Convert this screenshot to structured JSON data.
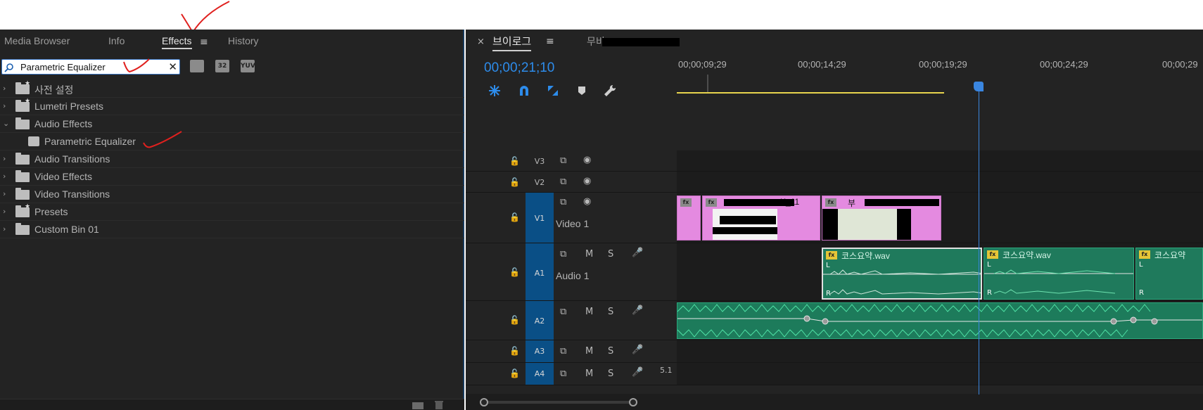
{
  "effects_panel": {
    "tabs": [
      {
        "label": "Media Browser",
        "active": false
      },
      {
        "label": "Info",
        "active": false
      },
      {
        "label": "Effects",
        "active": true
      },
      {
        "label": "History",
        "active": false
      }
    ],
    "menu_glyph": "≡",
    "search": {
      "value": "Parametric Equalizer",
      "clear_glyph": "✕"
    },
    "toolbar": {
      "accelerated": "",
      "bit32": "32",
      "yuv": "YUV"
    },
    "tree": [
      {
        "label": "사전 설정",
        "expanded": false,
        "preset": true
      },
      {
        "label": "Lumetri Presets",
        "expanded": false,
        "preset": true
      },
      {
        "label": "Audio Effects",
        "expanded": true,
        "preset": false
      },
      {
        "label": "Parametric Equalizer",
        "child": true
      },
      {
        "label": "Audio Transitions",
        "expanded": false,
        "preset": false
      },
      {
        "label": "Video Effects",
        "expanded": false,
        "preset": false
      },
      {
        "label": "Video Transitions",
        "expanded": false,
        "preset": false
      },
      {
        "label": "Presets",
        "expanded": false,
        "preset": true
      },
      {
        "label": "Custom Bin 01",
        "expanded": false,
        "preset": false
      }
    ]
  },
  "timeline": {
    "close_glyph": "×",
    "sequence_name": "브이로그",
    "sequence_menu": "≡",
    "sequence2_prefix": "무비",
    "timecode": "00;00;21;10",
    "ruler_labels": [
      "00;00;09;29",
      "00;00;14;29",
      "00;00;19;29",
      "00;00;24;29",
      "00;00;29"
    ],
    "tracks": [
      {
        "id": "V3",
        "type": "video",
        "name": "",
        "target": false
      },
      {
        "id": "V2",
        "type": "video",
        "name": "",
        "target": false
      },
      {
        "id": "V1",
        "type": "video",
        "name": "Video 1",
        "target": true
      },
      {
        "id": "A1",
        "type": "audio",
        "name": "Audio 1",
        "target": true
      },
      {
        "id": "A2",
        "type": "audio",
        "name": "",
        "target": true
      },
      {
        "id": "A3",
        "type": "audio",
        "name": "",
        "target": true
      },
      {
        "id": "A4",
        "type": "audio",
        "name": "",
        "target": true,
        "extra": "5.1"
      }
    ],
    "audio_header_labels": {
      "mute": "M",
      "solo": "S"
    },
    "clips": {
      "v1_a": {
        "label": "fx"
      },
      "v1_b": {
        "label": "K_11"
      },
      "v1_c": {
        "label": "부"
      },
      "a1_a": {
        "label": "코스요약.wav"
      },
      "a1_b": {
        "label": "코스요약.wav"
      },
      "a1_c": {
        "label": "코스요약"
      }
    },
    "channel_labels": {
      "left": "L",
      "right": "R"
    }
  },
  "colors": {
    "accent_blue": "#2d8ceb",
    "video_clip": "#e48ae0",
    "audio_clip": "#1f7a5c",
    "target_track": "#0a4f86",
    "annotation_red": "#e0201e"
  }
}
